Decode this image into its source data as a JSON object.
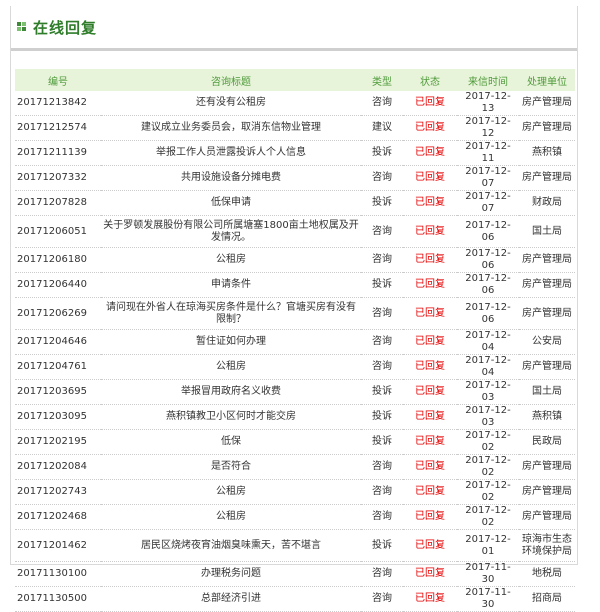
{
  "panel": {
    "title": "在线回复"
  },
  "table": {
    "headers": {
      "id": "编号",
      "subject": "咨询标题",
      "type": "类型",
      "status": "状态",
      "date": "来信时间",
      "unit": "处理单位"
    },
    "rows": [
      {
        "id": "20171213842",
        "subject": "还有没有公租房",
        "type": "咨询",
        "status": "已回复",
        "date": "2017-12-13",
        "unit": "房产管理局"
      },
      {
        "id": "20171212574",
        "subject": "建议成立业务委员会，取消东信物业管理",
        "type": "建议",
        "status": "已回复",
        "date": "2017-12-12",
        "unit": "房产管理局"
      },
      {
        "id": "20171211139",
        "subject": "举报工作人员泄露投诉人个人信息",
        "type": "投诉",
        "status": "已回复",
        "date": "2017-12-11",
        "unit": "燕积镇"
      },
      {
        "id": "20171207332",
        "subject": "共用设施设备分摊电费",
        "type": "咨询",
        "status": "已回复",
        "date": "2017-12-07",
        "unit": "房产管理局"
      },
      {
        "id": "20171207828",
        "subject": "低保申请",
        "type": "投诉",
        "status": "已回复",
        "date": "2017-12-07",
        "unit": "财政局"
      },
      {
        "id": "20171206051",
        "subject": "关于罗顿发展股份有限公司所属塘塞1800亩土地权属及开发情况。",
        "type": "咨询",
        "status": "已回复",
        "date": "2017-12-06",
        "unit": "国土局",
        "tall": true
      },
      {
        "id": "20171206180",
        "subject": "公租房",
        "type": "咨询",
        "status": "已回复",
        "date": "2017-12-06",
        "unit": "房产管理局"
      },
      {
        "id": "20171206440",
        "subject": "申请条件",
        "type": "投诉",
        "status": "已回复",
        "date": "2017-12-06",
        "unit": "房产管理局"
      },
      {
        "id": "20171206269",
        "subject": "请问现在外省人在琼海买房条件是什么？官塘买房有没有限制？",
        "type": "咨询",
        "status": "已回复",
        "date": "2017-12-06",
        "unit": "房产管理局",
        "tall": true
      },
      {
        "id": "20171204646",
        "subject": "暂住证如何办理",
        "type": "咨询",
        "status": "已回复",
        "date": "2017-12-04",
        "unit": "公安局"
      },
      {
        "id": "20171204761",
        "subject": "公租房",
        "type": "咨询",
        "status": "已回复",
        "date": "2017-12-04",
        "unit": "房产管理局"
      },
      {
        "id": "20171203695",
        "subject": "举报冒用政府名义收费",
        "type": "投诉",
        "status": "已回复",
        "date": "2017-12-03",
        "unit": "国土局"
      },
      {
        "id": "20171203095",
        "subject": "燕积镇教卫小区何时才能交房",
        "type": "投诉",
        "status": "已回复",
        "date": "2017-12-03",
        "unit": "燕积镇"
      },
      {
        "id": "20171202195",
        "subject": "低保",
        "type": "投诉",
        "status": "已回复",
        "date": "2017-12-02",
        "unit": "民政局"
      },
      {
        "id": "20171202084",
        "subject": "是否符合",
        "type": "咨询",
        "status": "已回复",
        "date": "2017-12-02",
        "unit": "房产管理局"
      },
      {
        "id": "20171202743",
        "subject": "公租房",
        "type": "咨询",
        "status": "已回复",
        "date": "2017-12-02",
        "unit": "房产管理局"
      },
      {
        "id": "20171202468",
        "subject": "公租房",
        "type": "咨询",
        "status": "已回复",
        "date": "2017-12-02",
        "unit": "房产管理局"
      },
      {
        "id": "20171201462",
        "subject": "居民区烧烤夜宵油烟臭味熏天，苦不堪言",
        "type": "投诉",
        "status": "已回复",
        "date": "2017-12-01",
        "unit": "琼海市生态环境保护局",
        "tall": true
      },
      {
        "id": "20171130100",
        "subject": "办理税务问题",
        "type": "咨询",
        "status": "已回复",
        "date": "2017-11-30",
        "unit": "地税局"
      },
      {
        "id": "20171130500",
        "subject": "总部经济引进",
        "type": "咨询",
        "status": "已回复",
        "date": "2017-11-30",
        "unit": "招商局"
      }
    ]
  }
}
